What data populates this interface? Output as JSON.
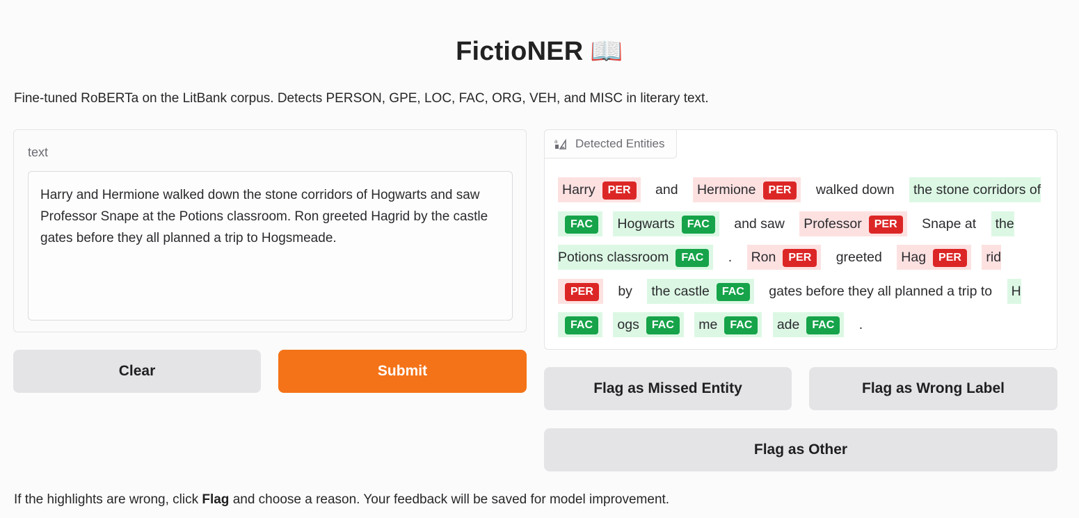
{
  "header": {
    "title": "FictioNER",
    "title_emoji": "📖"
  },
  "description": "Fine-tuned RoBERTa on the LitBank corpus. Detects PERSON, GPE, LOC, FAC, ORG, VEH, and MISC in literary text.",
  "input": {
    "label": "text",
    "value": "Harry and Hermione walked down the stone corridors of Hogwarts and saw Professor Snape at the Potions classroom. Ron greeted Hagrid by the castle gates before they all planned a trip to Hogsmeade."
  },
  "buttons": {
    "clear": "Clear",
    "submit": "Submit",
    "flag_missed": "Flag as Missed Entity",
    "flag_wrong": "Flag as Wrong Label",
    "flag_other": "Flag as Other"
  },
  "output": {
    "tab_label": "Detected Entities",
    "tab_icon": "text-highlight-icon",
    "tokens": [
      {
        "text": "Harry",
        "label": "PER"
      },
      {
        "text": "and",
        "label": null
      },
      {
        "text": "Hermione",
        "label": "PER"
      },
      {
        "text": "walked down",
        "label": null
      },
      {
        "text": "the stone corridors of",
        "label": "FAC"
      },
      {
        "text": "Hogwarts",
        "label": "FAC"
      },
      {
        "text": "and saw",
        "label": null
      },
      {
        "text": "Professor",
        "label": "PER"
      },
      {
        "text": "Snape at",
        "label": null
      },
      {
        "text": "the Potions classroom",
        "label": "FAC"
      },
      {
        "text": ".",
        "label": null
      },
      {
        "text": "Ron",
        "label": "PER"
      },
      {
        "text": "greeted",
        "label": null
      },
      {
        "text": "Hag",
        "label": "PER"
      },
      {
        "text": "rid",
        "label": "PER"
      },
      {
        "text": "by",
        "label": null
      },
      {
        "text": "the castle",
        "label": "FAC"
      },
      {
        "text": "gates before they all planned a trip to",
        "label": null
      },
      {
        "text": "H",
        "label": "FAC"
      },
      {
        "text": "ogs",
        "label": "FAC"
      },
      {
        "text": "me",
        "label": "FAC"
      },
      {
        "text": "ade",
        "label": "FAC"
      },
      {
        "text": ".",
        "label": null
      }
    ],
    "colors": {
      "per_badge": "#dc2626",
      "per_bg": "#fde1e1",
      "fac_badge": "#16a34a",
      "fac_bg": "#dcf8e4"
    }
  },
  "footer": {
    "before": "If the highlights are wrong, click ",
    "bold": "Flag",
    "after": " and choose a reason. Your feedback will be saved for model improvement."
  },
  "colors": {
    "accent": "#f47318",
    "button_gray": "#e4e4e7"
  }
}
